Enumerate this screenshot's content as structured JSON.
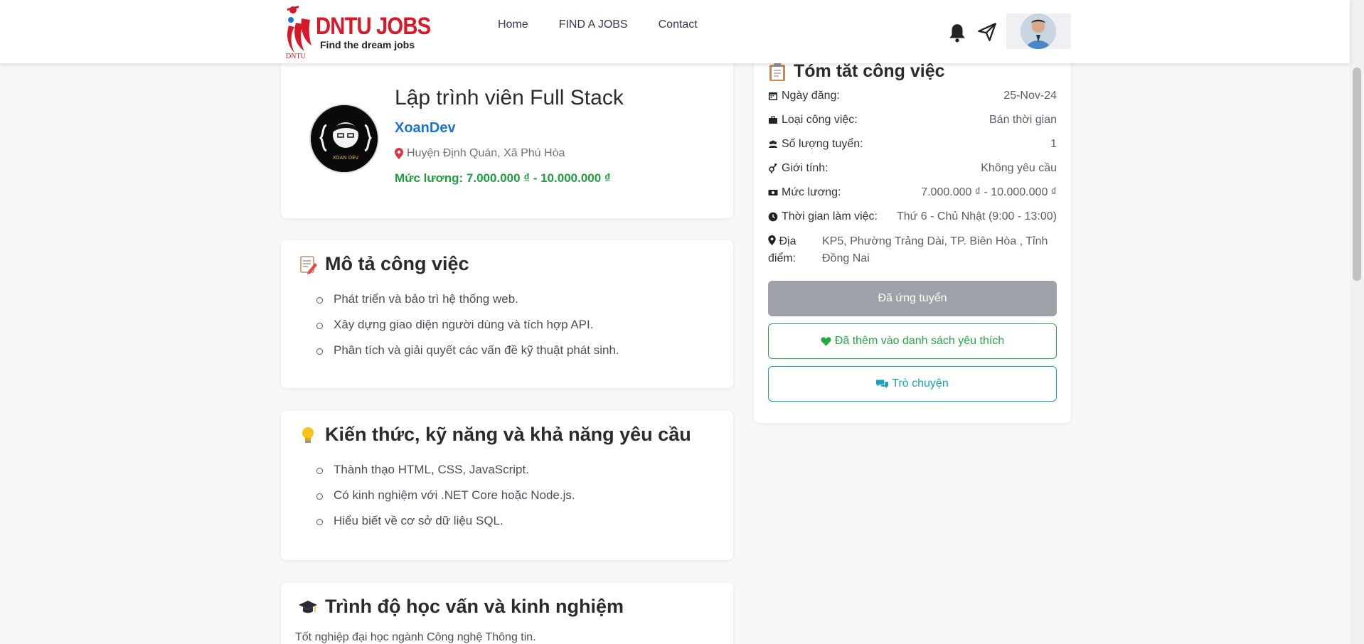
{
  "header": {
    "logo_title": "DNTU JOBS",
    "logo_subtitle": "Find the dream jobs",
    "logo_badge": "DNTU",
    "nav": [
      {
        "label": "Home"
      },
      {
        "label": "FIND A JOBS"
      },
      {
        "label": "Contact"
      }
    ]
  },
  "job": {
    "title": "Lập trình viên Full Stack",
    "company": "XoanDev",
    "company_logo_text": "XOAN DEV",
    "location": "Huyện Định Quán, Xã Phú Hòa",
    "salary": "Mức lương: 7.000.000 ₫ - 10.000.000 ₫"
  },
  "description": {
    "title": "Mô tả công việc",
    "items": [
      "Phát triển và bảo trì hệ thống web.",
      "Xây dựng giao diện người dùng và tích hợp API.",
      "Phân tích và giải quyết các vấn đề kỹ thuật phát sinh."
    ]
  },
  "skills": {
    "title": "Kiến thức, kỹ năng và khả năng yêu cầu",
    "items": [
      "Thành thạo HTML, CSS, JavaScript.",
      "Có kinh nghiệm với .NET Core hoặc Node.js.",
      "Hiểu biết về cơ sở dữ liệu SQL."
    ]
  },
  "education": {
    "title": "Trình độ học vấn và kinh nghiệm",
    "text": "Tốt nghiệp đại học ngành Công nghệ Thông tin."
  },
  "summary": {
    "title": "Tóm tắt công việc",
    "rows": [
      {
        "label": "Ngày đăng:",
        "value": "25-Nov-24"
      },
      {
        "label": "Loại công việc:",
        "value": "Bán thời gian"
      },
      {
        "label": "Số lượng tuyển:",
        "value": "1"
      },
      {
        "label": "Giới tính:",
        "value": "Không yêu cầu"
      },
      {
        "label": "Mức lương:",
        "value": "7.000.000 ₫ - 10.000.000 ₫"
      },
      {
        "label": "Thời gian làm việc:",
        "value": "Thứ 6 - Chủ Nhật (9:00 - 13:00)"
      }
    ],
    "address_label": "Địa điểm:",
    "address_value": "KP5, Phường Trảng Dài, TP. Biên Hòa , Tỉnh Đồng Nai",
    "btn_applied": "Đã ứng tuyển",
    "btn_favorite": "Đã thêm vào danh sách yêu thích",
    "btn_chat": "Trò chuyện"
  },
  "colors": {
    "brand": "#d7192a",
    "company": "#1b74d6",
    "salary": "#1e9e3e",
    "favorite": "#28a745",
    "chat": "#17a2b8",
    "applied": "#9ea2a8"
  }
}
